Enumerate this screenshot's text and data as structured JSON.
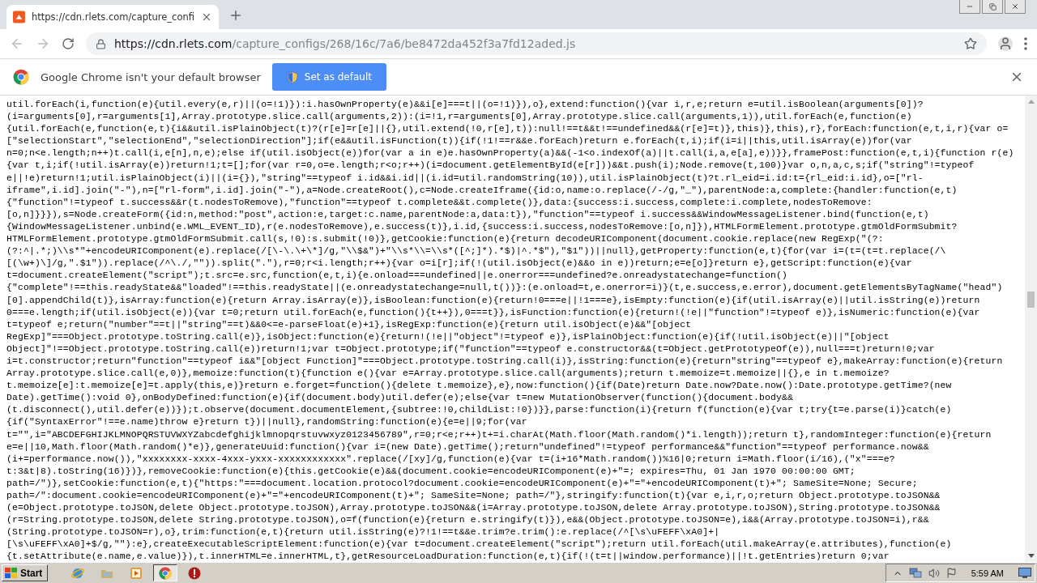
{
  "browser": {
    "tab": {
      "title": "https://cdn.rlets.com/capture_confi",
      "selected": true
    },
    "address": {
      "host": "https://cdn.rlets.com",
      "path": "/capture_configs/268/16c/7a6/be8472da452f3a7fd12aded.js"
    }
  },
  "infobar": {
    "message": "Google Chrome isn't your default browser",
    "button": "Set as default"
  },
  "code_lines": [
    "util.forEach(i,function(e){util.every(e,r)||(o=!1)}):i.hasOwnProperty(e)&&i[e]===t||(o=!1)}),o},extend:function(){var i,r,e;return e=util.isBoolean(arguments[0])?",
    "(i=arguments[0],r=arguments[1],Array.prototype.slice.call(arguments,2)):(i=!1,r=arguments[0],Array.prototype.slice.call(arguments,1)),util.forEach(e,function(e)",
    "{util.forEach(e,function(e,t){i&&util.isPlainObject(t)?(r[e]=r[e]||{},util.extend(!0,r[e],t)):null!==t&&t!==undefined&&(r[e]=t)},this)},this),r},forEach:function(e,t,i,r){var o=",
    "[\"selectionStart\",\"selectionEnd\",\"selectionDirection\"];if(e&&util.isFunction(t)){if(!1!==r&&e.forEach)return e.forEach(t,i);if(i=i||this,util.isArray(e))for(var",
    "n=0;n<e.length;n++)t.call(i,e[n],n,e);else if(util.isObject(e))for(var a in e)e.hasOwnProperty(a)&&(-1<o.indexOf(a)||t.call(i,a,e[a],e))}},framePost:function(e,t,i){function r(e)",
    "{var t,i;if(!util.isArray(e))return!1;t=[];for(var r=0,o=e.length;r<o;r++)(i=document.getElementById(e[r]))&&t.push(i);Node.remove(t,100)}var o,n,a,c,s;if(\"string\"!=typeof",
    "e||!e)return!1;util.isPlainObject(i)||(i={}),\"string\"==typeof i.id&&i.id||(i.id=util.randomString(10)),util.isPlainObject(t)?t.rl_eid=i.id:t={rl_eid:i.id},o=[\"rl-",
    "iframe\",i.id].join(\"-\"),n=[\"rl-form\",i.id].join(\"-\"),a=Node.createRoot(),c=Node.createIframe({id:o,name:o.replace(/-/g,\"_\"),parentNode:a,complete:{handler:function(e,t)",
    "{\"function\"!=typeof t.success&&r(t.nodesToRemove),\"function\"==typeof t.complete&&t.complete()},data:{success:i.success,complete:i.complete,nodesToRemove:",
    "[o,n]}}}),s=Node.createForm({id:n,method:\"post\",action:e,target:c.name,parentNode:a,data:t}),\"function\"==typeof i.success&&WindowMessageListener.bind(function(e,t)",
    "{WindowMessageListener.unbind(e.WML_EVENT_ID),r(e.nodesToRemove),e.success(t)},i.id,{success:i.success,nodesToRemove:[o,n]}),HTMLFormElement.prototype.gtmOldFormSubmit?",
    "HTMLFormElement.prototype.gtmOldFormSubmit.call(s,!0):s.submit(!0)},getCookie:function(e){return decodeURIComponent(document.cookie.replace(new RegExp(\"(?:",
    "(?:^|.*;)\\\\s*\"+encodeURIComponent(e).replace(/[\\-\\.\\+\\*]/g,\"\\\\$&\")+\"\\\\s*\\\\=\\\\s*([^;]*).*$)|^.*$\"),\"$1\"))||null},getProperty:function(e,t){for(var i=(t=(t=t.replace(/\\",
    "[(\\w+)\\]/g,\".$1\")).replace(/^\\./,\"\")).split(\".\"),r=0;r<i.length;r++){var o=i[r];if(!(util.isObject(e)&&o in e))return;e=e[o]}return e},getScript:function(e){var",
    "t=document.createElement(\"script\");t.src=e.src,function(e,t,i){e.onload===undefined||e.onerror===undefined?e.onreadystatechange=function()",
    "{\"complete\"!==this.readyState&&\"loaded\"!==this.readyState||(e.onreadystatechange=null,t())}:(e.onload=t,e.onerror=i)}(t,e.success,e.error),document.getElementsByTagName(\"head\")",
    "[0].appendChild(t)},isArray:function(e){return Array.isArray(e)},isBoolean:function(e){return!0===e||!1===e},isEmpty:function(e){if(util.isArray(e)||util.isString(e))return",
    "0===e.length;if(util.isObject(e)){var t=0;return util.forEach(e,function(){t++}),0===t}},isFunction:function(e){return!(!e||\"function\"!=typeof e)},isNumeric:function(e){var",
    "t=typeof e;return(\"number\"==t||\"string\"==t)&&0<=e-parseFloat(e)+1},isRegExp:function(e){return util.isObject(e)&&\"[object",
    "RegExp]\"===Object.prototype.toString.call(e)},isObject:function(e){return!(!e||\"object\"!=typeof e)},isPlainObject:function(e){if(!util.isObject(e)||\"[object",
    "Object]\"!==Object.prototype.toString.call(e))return!1;var t=Object.prototype;if(\"function\"==typeof e.constructor&&(t=Object.getPrototypeOf(e)),null===t)return!0;var",
    "i=t.constructor;return\"function\"==typeof i&&\"[object Function]\"===Object.prototype.toString.call(i)},isString:function(e){return\"string\"==typeof e},makeArray:function(e){return",
    "Array.prototype.slice.call(e,0)},memoize:function(t){function e(){var e=Array.prototype.slice.call(arguments);return t.memoize=t.memoize||{},e in t.memoize?",
    "t.memoize[e]:t.memoize[e]=t.apply(this,e)}return e.forget=function(){delete t.memoize},e},now:function(){if(Date)return Date.now?Date.now():Date.prototype.getTime?(new",
    "Date).getTime():void 0},onBodyDefined:function(e){if(document.body)util.defer(e);else{var t=new MutationObserver(function(){document.body&&",
    "(t.disconnect(),util.defer(e))});t.observe(document.documentElement,{subtree:!0,childList:!0})}},parse:function(i){return f(function(e){var t;try{t=e.parse(i)}catch(e)",
    "{if(\"SyntaxError\"!==e.name)throw e}return t})||null},randomString:function(e){e=e||9;for(var",
    "t=\"\",i=\"ABCDEFGHIJKLMNOPQRSTUVWXYZabcdefghijklmnopqrstuvwxyz0123456789\",r=0;r<e;r++)t+=i.charAt(Math.floor(Math.random()*i.length));return t},randomInteger:function(e){return",
    "e=e||10,Math.floor(Math.random()*e)},generateUuid:function(){var i=(new Date).getTime();return\"undefined\"!=typeof performance&&\"function\"==typeof performance.now&&",
    "(i+=performance.now()),\"xxxxxxxx-xxxx-4xxx-yxxx-xxxxxxxxxxxx\".replace(/[xy]/g,function(e){var t=(i+16*Math.random())%16|0;return i=Math.floor(i/16),(\"x\"===e?",
    "t:3&t|8).toString(16)})},removeCookie:function(e){this.getCookie(e)&&(document.cookie=encodeURIComponent(e)+\"=; expires=Thu, 01 Jan 1970 00:00:00 GMT;",
    "path=/\")},setCookie:function(e,t){\"https:\"===document.location.protocol?document.cookie=encodeURIComponent(e)+\"=\"+encodeURIComponent(t)+\"; SameSite=None; Secure;",
    "path=/\":document.cookie=encodeURIComponent(e)+\"=\"+encodeURIComponent(t)+\"; SameSite=None; path=/\"},stringify:function(t){var e,i,r,o;return Object.prototype.toJSON&&",
    "(e=Object.prototype.toJSON,delete Object.prototype.toJSON),Array.prototype.toJSON&&(i=Array.prototype.toJSON,delete Array.prototype.toJSON),String.prototype.toJSON&&",
    "(r=String.prototype.toJSON,delete String.prototype.toJSON),o=f(function(e){return e.stringify(t)}),e&&(Object.prototype.toJSON=e),i&&(Array.prototype.toJSON=i),r&&",
    "(String.prototype.toJSON=r),o},trim:function(e,t){return util.isString(e)?!1!==t&&e.trim?e.trim():e.replace(/^[\\s\\uFEFF\\xA0]+|",
    "[\\s\\uFEFF\\xA0]+$/g,\"\"):e},createExecutableScriptElement:function(e){var t=document.createElement(\"script\");return util.forEach(util.makeArray(e.attributes),function(e)",
    "{t.setAttribute(e.name,e.value)}),t.innerHTML=e.innerHTML,t},getResourceLoadDuration:function(e,t){if(!(t=t||window.performance)||!t.getEntries)return 0;var"
  ],
  "taskbar": {
    "start": "Start",
    "tasks": [
      {
        "kind": "ie",
        "selected": false
      },
      {
        "kind": "folder",
        "selected": false
      },
      {
        "kind": "media",
        "selected": false
      },
      {
        "kind": "chrome",
        "selected": true
      },
      {
        "kind": "stop",
        "selected": false
      }
    ],
    "clock": "5:59 AM"
  }
}
